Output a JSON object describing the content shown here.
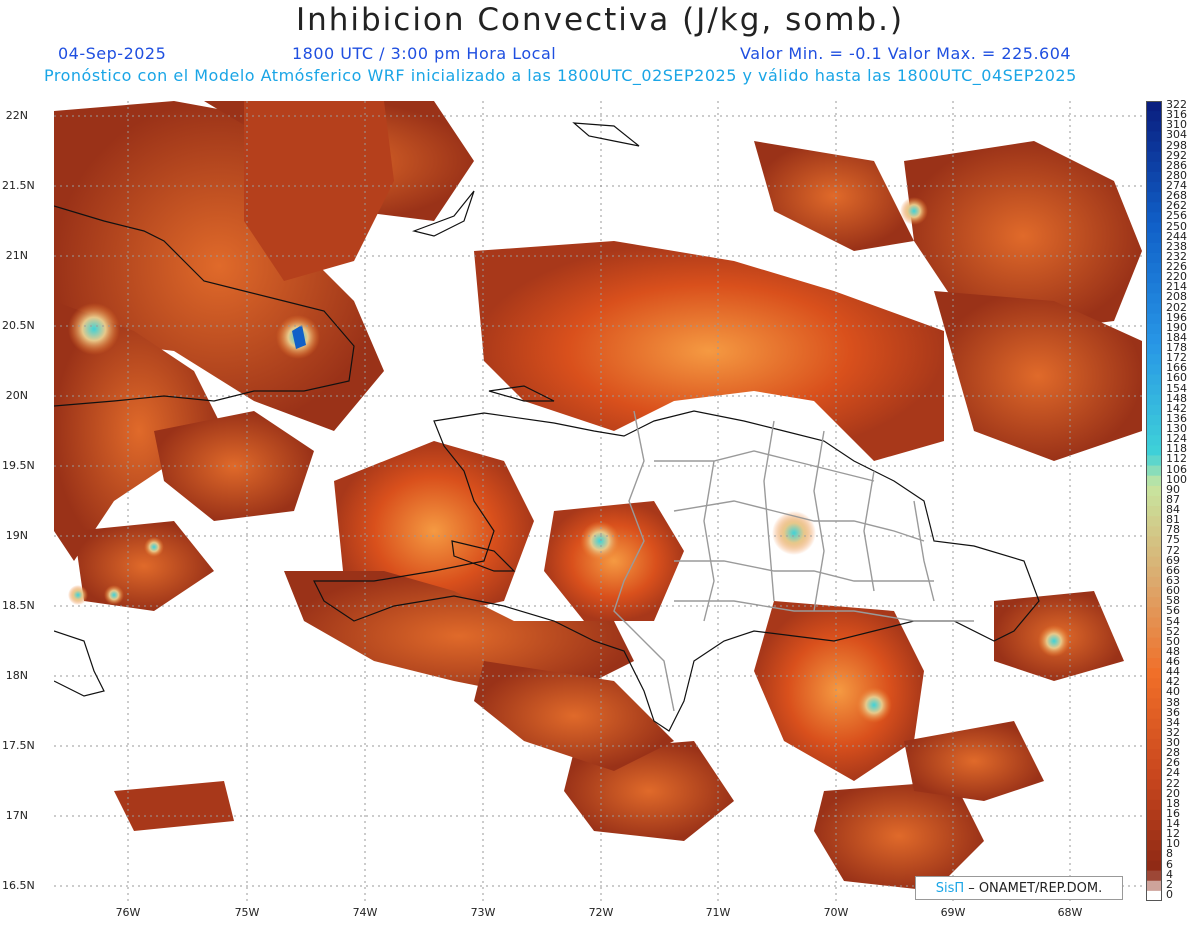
{
  "header": {
    "title": "Inhibicion Convectiva (J/kg, somb.)",
    "date": "04-Sep-2025",
    "time": "1800 UTC / 3:00 pm Hora Local",
    "min_max": "Valor Min. = -0.1  Valor Max. = 225.604",
    "model_info": "Pronóstico con el Modelo Atmósferico WRF inicializado a las 1800UTC_02SEP2025 y válido hasta las  1800UTC_04SEP2025"
  },
  "axes": {
    "lat_labels": [
      "22N",
      "21.5N",
      "21N",
      "20.5N",
      "20N",
      "19.5N",
      "19N",
      "18.5N",
      "18N",
      "17.5N",
      "17N",
      "16.5N"
    ],
    "lon_labels": [
      "76W",
      "75W",
      "74W",
      "73W",
      "72W",
      "71W",
      "70W",
      "69W",
      "68W"
    ]
  },
  "legend": {
    "values": [
      "322",
      "316",
      "310",
      "304",
      "298",
      "292",
      "286",
      "280",
      "274",
      "268",
      "262",
      "256",
      "250",
      "244",
      "238",
      "232",
      "226",
      "220",
      "214",
      "208",
      "202",
      "196",
      "190",
      "184",
      "178",
      "172",
      "166",
      "160",
      "154",
      "148",
      "142",
      "136",
      "130",
      "124",
      "118",
      "112",
      "106",
      "100",
      "90",
      "87",
      "84",
      "81",
      "78",
      "75",
      "72",
      "69",
      "66",
      "63",
      "60",
      "58",
      "56",
      "54",
      "52",
      "50",
      "48",
      "46",
      "44",
      "42",
      "40",
      "38",
      "36",
      "34",
      "32",
      "30",
      "28",
      "26",
      "24",
      "22",
      "20",
      "18",
      "16",
      "14",
      "12",
      "10",
      "8",
      "6",
      "4",
      "2",
      "0"
    ]
  },
  "colors": {
    "low": "#8a2a14",
    "mid": "#d9501c",
    "high_orange": "#f07a2a",
    "light": "#e7c88a",
    "cyan": "#3fd2d8",
    "blue": "#1060c8",
    "dark_blue": "#0a1f80",
    "coast": "#111111",
    "border": "#9a9a9a"
  },
  "credit": {
    "brand": "SisΠ",
    "text": "– ONAMET/REP.DOM."
  }
}
